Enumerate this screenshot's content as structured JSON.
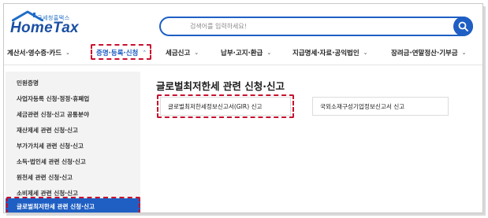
{
  "header": {
    "logo_sub": "국세청홈택스",
    "logo_main": "HomeTax",
    "search_placeholder": "검색어를 입력하세요!"
  },
  "nav": {
    "items": [
      {
        "label": "계산서·영수증·카드",
        "chevron": "⌄"
      },
      {
        "label": "증명·등록·신청",
        "chevron": "⌃",
        "active": true
      },
      {
        "label": "세금신고",
        "chevron": "⌄"
      },
      {
        "label": "납부·고지·환급",
        "chevron": "⌄"
      },
      {
        "label": "지급명세·자료·공익법인",
        "chevron": "⌄"
      },
      {
        "label": "장려금·연말정산·기부금",
        "chevron": "⌄"
      }
    ]
  },
  "sidebar": {
    "items": [
      {
        "label": "민원증명"
      },
      {
        "label": "사업자등록 신청·정정·휴폐업"
      },
      {
        "label": "세금관련 신청·신고 공통분야"
      },
      {
        "label": "재산제세 관련 신청·신고"
      },
      {
        "label": "부가가치세 관련 신청·신고"
      },
      {
        "label": "소득·법인세 관련 신청·신고"
      },
      {
        "label": "원천세 관련 신청·신고"
      },
      {
        "label": "소비제세 관련 신청·신고"
      },
      {
        "label": "글로벌최저한세 관련 신청·신고",
        "active": true
      }
    ]
  },
  "main": {
    "title": "글로벌최저한세 관련 신청·신고",
    "cards": [
      {
        "label": "글로벌최저한세정보신고서(GIR) 신고"
      },
      {
        "label": "국외소재구성기업정보신고서 신고"
      }
    ]
  },
  "colors": {
    "brand": "#1f5fc4",
    "highlight": "#c8102e",
    "sidebar_bg": "#f3f3f3"
  }
}
